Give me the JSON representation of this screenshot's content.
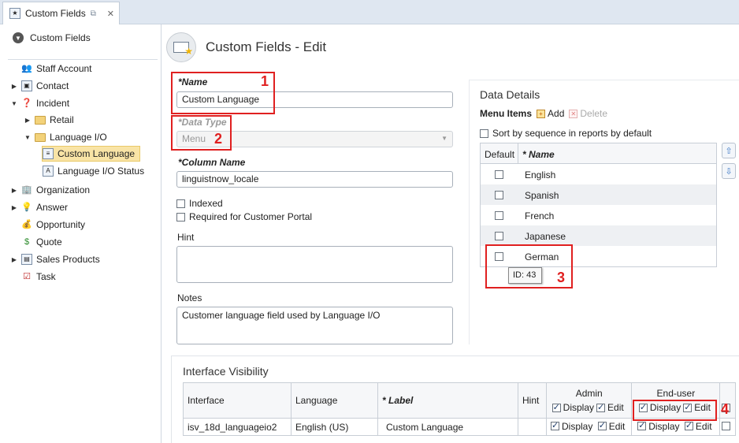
{
  "tab": {
    "title": "Custom Fields"
  },
  "sidebar": {
    "header": "Custom Fields",
    "items": [
      {
        "label": "Staff Account",
        "icon": "staff-icon"
      },
      {
        "label": "Contact",
        "icon": "contact-icon"
      },
      {
        "label": "Incident",
        "icon": "incident-icon"
      },
      {
        "label": "Retail",
        "icon": "folder-icon"
      },
      {
        "label": "Language I/O",
        "icon": "folder-icon"
      },
      {
        "label": "Custom Language",
        "icon": "menu-field-icon"
      },
      {
        "label": "Language I/O Status",
        "icon": "text-field-icon"
      },
      {
        "label": "Organization",
        "icon": "organization-icon"
      },
      {
        "label": "Answer",
        "icon": "answer-icon"
      },
      {
        "label": "Opportunity",
        "icon": "opportunity-icon"
      },
      {
        "label": "Quote",
        "icon": "quote-icon"
      },
      {
        "label": "Sales Products",
        "icon": "sales-products-icon"
      },
      {
        "label": "Task",
        "icon": "task-icon"
      }
    ]
  },
  "page": {
    "title": "Custom Fields - Edit"
  },
  "form": {
    "name_label": "*Name",
    "name_value": "Custom Language",
    "data_type_label": "*Data Type",
    "data_type_value": "Menu",
    "column_label": "*Column Name",
    "column_value": "linguistnow_locale",
    "indexed_label": "Indexed",
    "required_label": "Required for Customer Portal",
    "hint_label": "Hint",
    "hint_value": "",
    "notes_label": "Notes",
    "notes_value": "Customer language field used by Language I/O"
  },
  "data_details": {
    "title": "Data Details",
    "menu_items_label": "Menu Items",
    "add_label": "Add",
    "delete_label": "Delete",
    "sort_label": "Sort by sequence in reports by default",
    "col_default": "Default",
    "col_name": "* Name",
    "rows": [
      "English",
      "Spanish",
      "French",
      "Japanese",
      "German"
    ],
    "tooltip": "ID: 43"
  },
  "interface_visibility": {
    "title": "Interface Visibility",
    "headers": {
      "interface": "Interface",
      "language": "Language",
      "label": "* Label",
      "hint": "Hint",
      "admin": "Admin",
      "enduser": "End-user",
      "display": "Display",
      "edit": "Edit"
    },
    "row": {
      "interface": "isv_18d_languageio2",
      "language": "English (US)",
      "label": "Custom Language",
      "hint": ""
    }
  },
  "annotations": [
    "1",
    "2",
    "3",
    "4"
  ],
  "colors": {
    "annotation": "#e02020",
    "selected_bg": "#f9e4a6",
    "tab_bg": "#dfe7f1"
  }
}
